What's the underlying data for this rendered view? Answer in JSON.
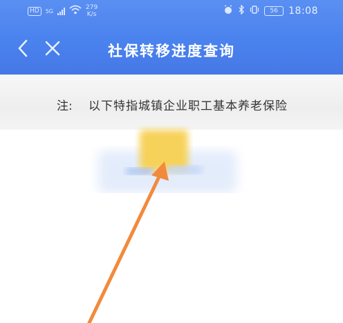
{
  "status_bar": {
    "left_chip": "HD",
    "network": "5G",
    "speed_value": "279",
    "speed_unit": "K/s",
    "battery": "56",
    "time": "18:08"
  },
  "nav": {
    "back_icon": "chevron-left-icon",
    "close_icon": "close-icon",
    "title": "社保转移进度查询"
  },
  "note": {
    "label": "注:",
    "text": "以下特指城镇企业职工基本养老保险"
  },
  "colors": {
    "header_blue": "#4a82ee",
    "arrow_orange": "#f28a3c",
    "folder_yellow": "#f7d25a"
  }
}
